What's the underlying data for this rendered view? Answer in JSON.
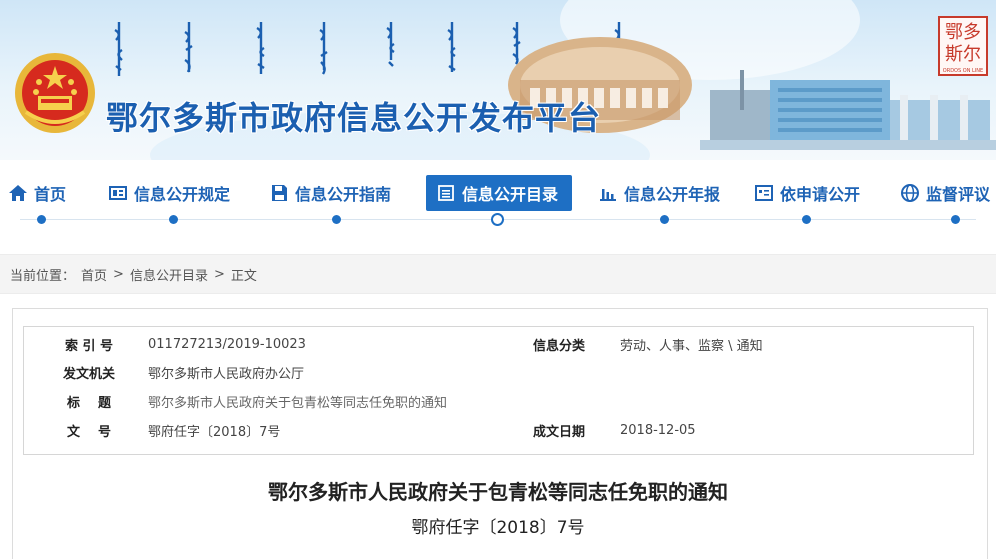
{
  "header": {
    "site_title": "鄂尔多斯市政府信息公开发布平台",
    "seal_text_top": "鄂多",
    "seal_text_bottom": "斯尔",
    "seal_caption": "ORDOS ON LINE"
  },
  "nav": {
    "items": [
      {
        "label": "首页",
        "icon": "home-icon",
        "active": false
      },
      {
        "label": "信息公开规定",
        "icon": "rules-icon",
        "active": false
      },
      {
        "label": "信息公开指南",
        "icon": "save-icon",
        "active": false
      },
      {
        "label": "信息公开目录",
        "icon": "list-icon",
        "active": true
      },
      {
        "label": "信息公开年报",
        "icon": "bar-chart-icon",
        "active": false
      },
      {
        "label": "依申请公开",
        "icon": "form-icon",
        "active": false
      },
      {
        "label": "监督评议",
        "icon": "globe-icon",
        "active": false
      }
    ]
  },
  "breadcrumb": {
    "prefix": "当前位置：",
    "home": "首页",
    "sep1": ">",
    "catalog": "信息公开目录",
    "sep2": ">",
    "current": "正文"
  },
  "meta": {
    "index_label": "索 引 号",
    "index_value": "011727213/2019-10023",
    "category_label": "信息分类",
    "category_value": "劳动、人事、监察 \\ 通知",
    "issuer_label": "发文机关",
    "issuer_value": "鄂尔多斯市人民政府办公厅",
    "title_label": "标    题",
    "title_value": "鄂尔多斯市人民政府关于包青松等同志任免职的通知",
    "docno_label": "文    号",
    "docno_value": "鄂府任字〔2018〕7号",
    "date_label": "成文日期",
    "date_value": "2018-12-05"
  },
  "document": {
    "title": "鄂尔多斯市人民政府关于包青松等同志任免职的通知",
    "number": "鄂府任字〔2018〕7号"
  },
  "colors": {
    "primary": "#1e6fc4",
    "title_blue": "#1b5fb0",
    "seal_red": "#c73a2b"
  }
}
